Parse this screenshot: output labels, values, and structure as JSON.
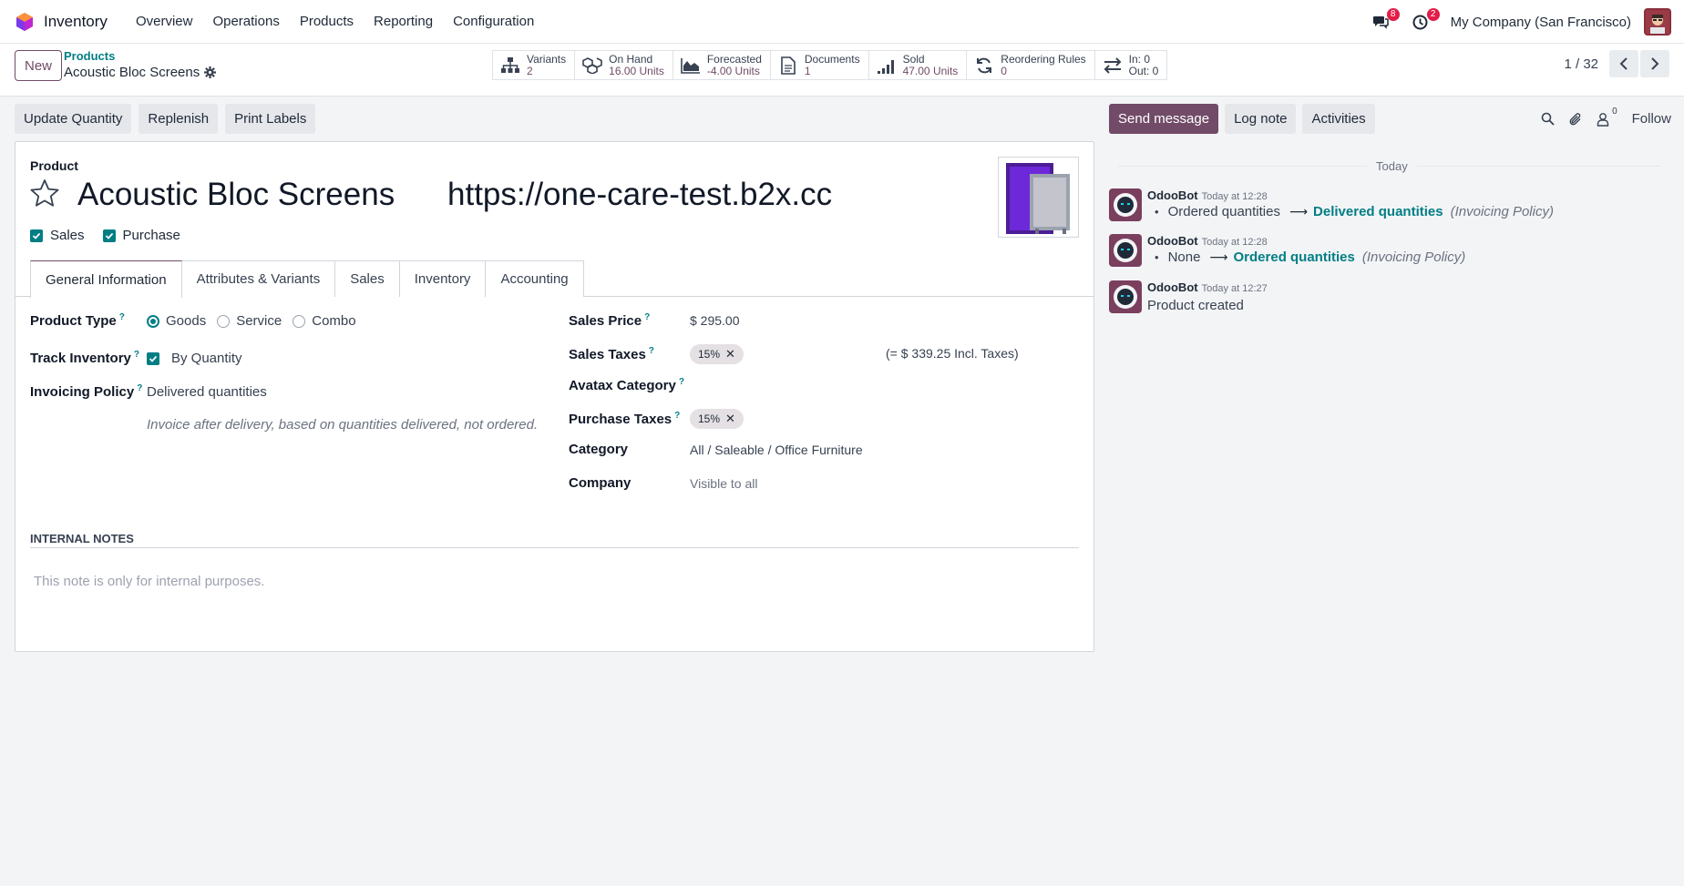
{
  "navbar": {
    "app_name": "Inventory",
    "menu": [
      "Overview",
      "Operations",
      "Products",
      "Reporting",
      "Configuration"
    ],
    "messages_badge": "8",
    "activities_badge": "2",
    "company": "My Company (San Francisco)"
  },
  "control": {
    "new_label": "New",
    "breadcrumb_parent": "Products",
    "breadcrumb_current": "Acoustic Bloc Screens",
    "pager": "1 / 32",
    "smart_buttons": [
      {
        "icon": "sitemap-icon",
        "label": "Variants",
        "value": "2"
      },
      {
        "icon": "cubes-icon",
        "label": "On Hand",
        "value": "16.00 Units"
      },
      {
        "icon": "area-chart-icon",
        "label": "Forecasted",
        "value": "-4.00 Units"
      },
      {
        "icon": "document-icon",
        "label": "Documents",
        "value": "1"
      },
      {
        "icon": "signal-icon",
        "label": "Sold",
        "value": "47.00 Units"
      },
      {
        "icon": "refresh-icon",
        "label": "Reordering Rules",
        "value": "0"
      },
      {
        "icon": "exchange-icon",
        "label": "In: 0",
        "value": "Out: 0"
      }
    ]
  },
  "actions": {
    "update_quantity": "Update Quantity",
    "replenish": "Replenish",
    "print_labels": "Print Labels"
  },
  "form": {
    "product_label": "Product",
    "name": "Acoustic Bloc Screens",
    "url": "https://one-care-test.b2x.cc",
    "sales_label": "Sales",
    "purchase_label": "Purchase",
    "tabs": [
      "General Information",
      "Attributes & Variants",
      "Sales",
      "Inventory",
      "Accounting"
    ],
    "product_type_label": "Product Type",
    "product_type_options": [
      "Goods",
      "Service",
      "Combo"
    ],
    "product_type_selected": "Goods",
    "track_inventory_label": "Track Inventory",
    "track_inventory_value": "By Quantity",
    "invoicing_policy_label": "Invoicing Policy",
    "invoicing_policy_value": "Delivered quantities",
    "invoicing_policy_hint": "Invoice after delivery, based on quantities delivered, not ordered.",
    "sales_price_label": "Sales Price",
    "sales_price_value": "$ 295.00",
    "sales_taxes_label": "Sales Taxes",
    "sales_taxes_tag": "15%",
    "sales_taxes_incl": "(= $ 339.25 Incl. Taxes)",
    "avatax_label": "Avatax Category",
    "purchase_taxes_label": "Purchase Taxes",
    "purchase_taxes_tag": "15%",
    "category_label": "Category",
    "category_value": "All / Saleable / Office Furniture",
    "company_label": "Company",
    "company_placeholder": "Visible to all",
    "internal_notes_title": "INTERNAL NOTES",
    "internal_notes_placeholder": "This note is only for internal purposes."
  },
  "chatter": {
    "send_message": "Send message",
    "log_note": "Log note",
    "activities": "Activities",
    "followers_count": "0",
    "follow": "Follow",
    "day": "Today",
    "messages": [
      {
        "author": "OdooBot",
        "time": "Today at 12:28",
        "old": "Ordered quantities",
        "new": "Delivered quantities",
        "field": "(Invoicing Policy)"
      },
      {
        "author": "OdooBot",
        "time": "Today at 12:28",
        "old": "None",
        "new": "Ordered quantities",
        "field": "(Invoicing Policy)"
      },
      {
        "author": "OdooBot",
        "time": "Today at 12:27",
        "text": "Product created"
      }
    ]
  },
  "colors": {
    "primary": "#714b67",
    "accent": "#017e84",
    "badge": "#e11d48"
  }
}
